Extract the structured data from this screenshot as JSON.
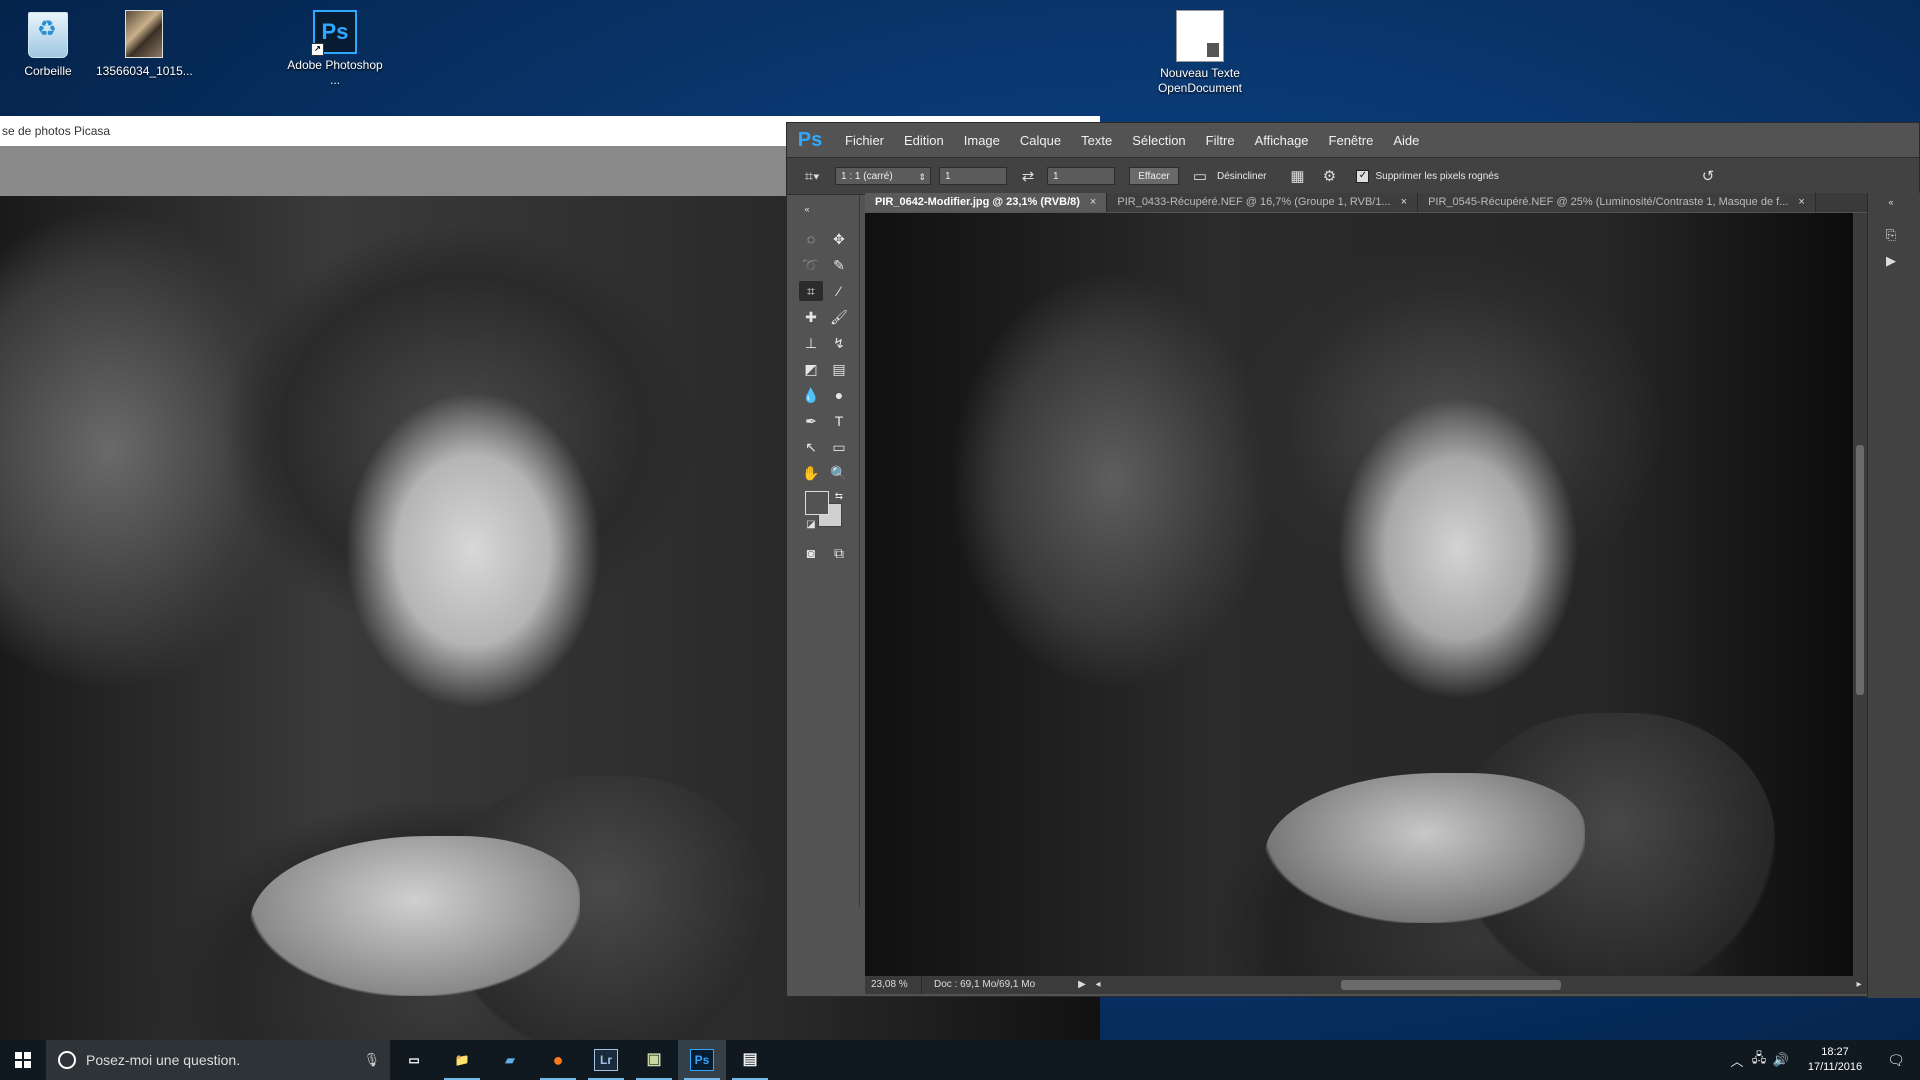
{
  "desktop": {
    "icons": [
      {
        "label": "Corbeille"
      },
      {
        "label": "13566034_1015..."
      },
      {
        "label": "Adobe Photoshop ..."
      },
      {
        "label": "Nouveau Texte OpenDocument"
      }
    ]
  },
  "picasa": {
    "title": "se de photos Picasa"
  },
  "photoshop": {
    "logo": "Ps",
    "menu": [
      "Fichier",
      "Edition",
      "Image",
      "Calque",
      "Texte",
      "Sélection",
      "Filtre",
      "Affichage",
      "Fenêtre",
      "Aide"
    ],
    "options": {
      "ratio": "1 : 1 (carré)",
      "width": "1",
      "height": "1",
      "clear_btn": "Effacer",
      "straighten": "Désincliner",
      "delete_cropped": "Supprimer les pixels rognés"
    },
    "tabs": [
      {
        "label": "PIR_0642-Modifier.jpg @ 23,1% (RVB/8)",
        "close": "×"
      },
      {
        "label": "PIR_0433-Récupéré.NEF @ 16,7% (Groupe 1, RVB/1...",
        "close": "×"
      },
      {
        "label": "PIR_0545-Récupéré.NEF @ 25% (Luminosité/Contraste 1, Masque de f...",
        "close": "×"
      }
    ],
    "status": {
      "zoom": "23,08 %",
      "doc": "Doc : 69,1 Mo/69,1 Mo"
    },
    "colors": {
      "foreground": "#535353",
      "background": "#cfcfcf"
    }
  },
  "taskbar": {
    "search_placeholder": "Posez-moi une question.",
    "apps": [
      {
        "name": "task-view",
        "glyph": "▭"
      },
      {
        "name": "file-explorer",
        "glyph": "📁"
      },
      {
        "name": "windows-explorer-alt",
        "glyph": "▰"
      },
      {
        "name": "firefox",
        "glyph": "●"
      },
      {
        "name": "lightroom",
        "glyph": "Lr"
      },
      {
        "name": "picasa",
        "glyph": "▣"
      },
      {
        "name": "photoshop",
        "glyph": "Ps"
      },
      {
        "name": "document-app",
        "glyph": "▤"
      }
    ],
    "time": "18:27",
    "date": "17/11/2016"
  }
}
